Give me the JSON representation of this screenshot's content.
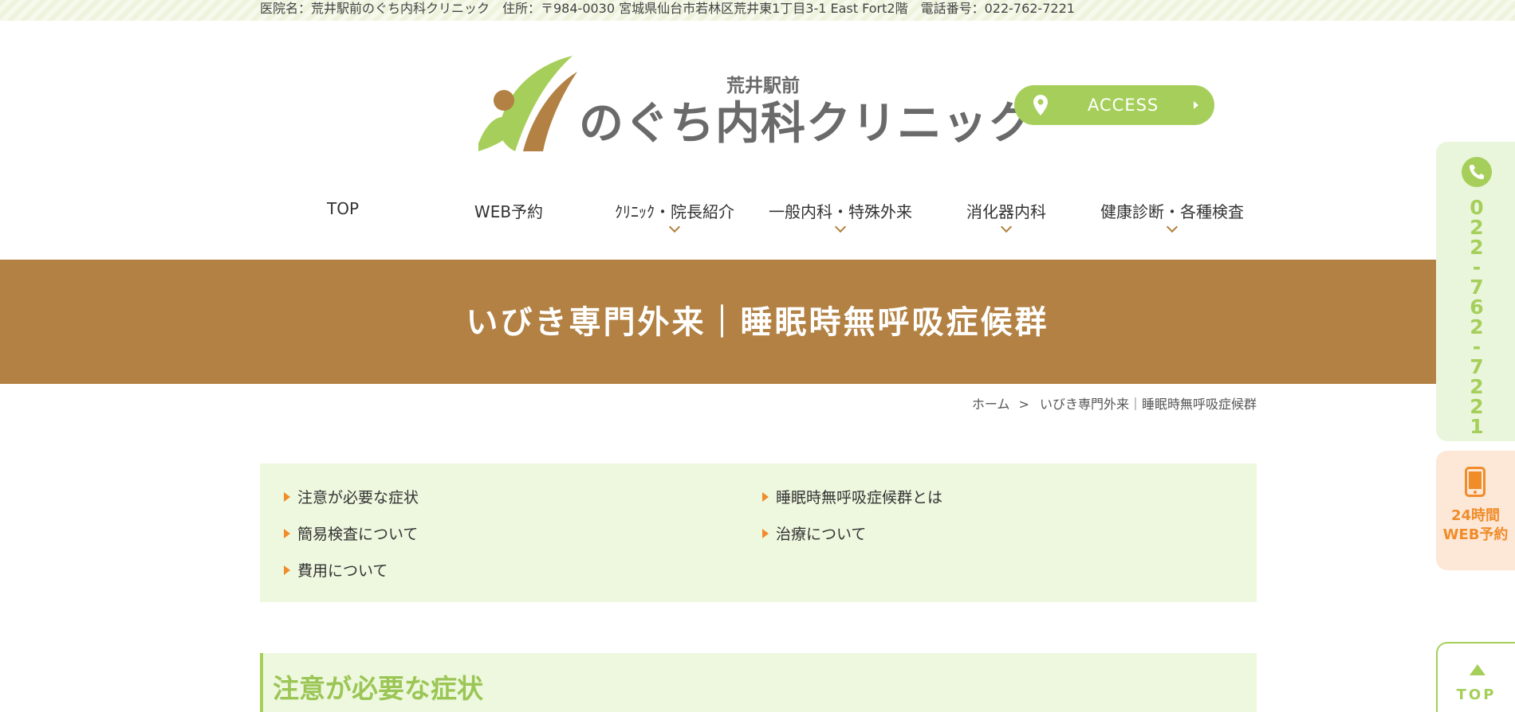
{
  "topbar": {
    "info": "医院名：荒井駅前のぐち内科クリニック　住所：〒984-0030 宮城県仙台市若林区荒井東1丁目3-1 East Fort2階　電話番号：022-762-7221"
  },
  "logo": {
    "sub": "荒井駅前",
    "main": "のぐち内科クリニック"
  },
  "access_button": {
    "label": "ACCESS"
  },
  "nav": {
    "items": [
      {
        "label": "TOP"
      },
      {
        "label": "WEB予約"
      },
      {
        "label": "ｸﾘﾆｯｸ・院長紹介"
      },
      {
        "label": "一般内科・特殊外来"
      },
      {
        "label": "消化器内科"
      },
      {
        "label": "健康診断・各種検査"
      }
    ]
  },
  "hero": {
    "title": "いびき専門外来｜睡眠時無呼吸症候群"
  },
  "breadcrumb": {
    "home": "ホーム",
    "separator": ">",
    "current": "いびき専門外来｜睡眠時無呼吸症候群"
  },
  "toc": {
    "links": [
      "注意が必要な症状",
      "睡眠時無呼吸症候群とは",
      "簡易検査について",
      "治療について",
      "費用について"
    ]
  },
  "section": {
    "title": "注意が必要な症状"
  },
  "side": {
    "tel_digits": [
      "0",
      "2",
      "2",
      "-",
      "7",
      "6",
      "2",
      "-",
      "7",
      "2",
      "2",
      "1"
    ],
    "web_line1": "24時間",
    "web_line2": "WEB予約",
    "top_label": "TOP"
  },
  "colors": {
    "green": "#a5cf5a",
    "brown": "#b28143",
    "orange": "#f08c2a",
    "light_green_bg": "#eef8df"
  }
}
